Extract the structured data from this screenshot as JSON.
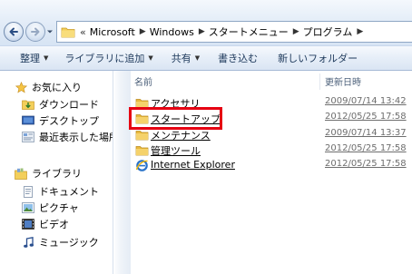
{
  "address": {
    "breadcrumbs": [
      "Microsoft",
      "Windows",
      "スタートメニュー",
      "プログラム"
    ],
    "lead_glyph": "«"
  },
  "toolbar": {
    "organize": "整理",
    "add_to_library": "ライブラリに追加",
    "share": "共有",
    "burn": "書き込む",
    "new_folder": "新しいフォルダー"
  },
  "nav": {
    "favorites": "お気に入り",
    "downloads": "ダウンロード",
    "desktop": "デスクトップ",
    "recent": "最近表示した場所",
    "libraries": "ライブラリ",
    "documents": "ドキュメント",
    "pictures": "ピクチャ",
    "videos": "ビデオ",
    "music": "ミュージック"
  },
  "columns": {
    "name": "名前",
    "date": "更新日時"
  },
  "files": [
    {
      "name": "アクセサリ",
      "date": "2009/07/14 13:42",
      "icon": "folder-icon"
    },
    {
      "name": "スタートアップ",
      "date": "2012/05/25 17:58",
      "icon": "folder-icon"
    },
    {
      "name": "メンテナンス",
      "date": "2009/07/14 13:37",
      "icon": "folder-icon"
    },
    {
      "name": "管理ツール",
      "date": "2012/05/25 17:58",
      "icon": "folder-icon"
    },
    {
      "name": "Internet Explorer",
      "date": "2012/05/25 17:58",
      "icon": "internet-explorer-icon"
    }
  ],
  "colors": {
    "highlight": "#e60012",
    "accent": "#1e395b"
  }
}
